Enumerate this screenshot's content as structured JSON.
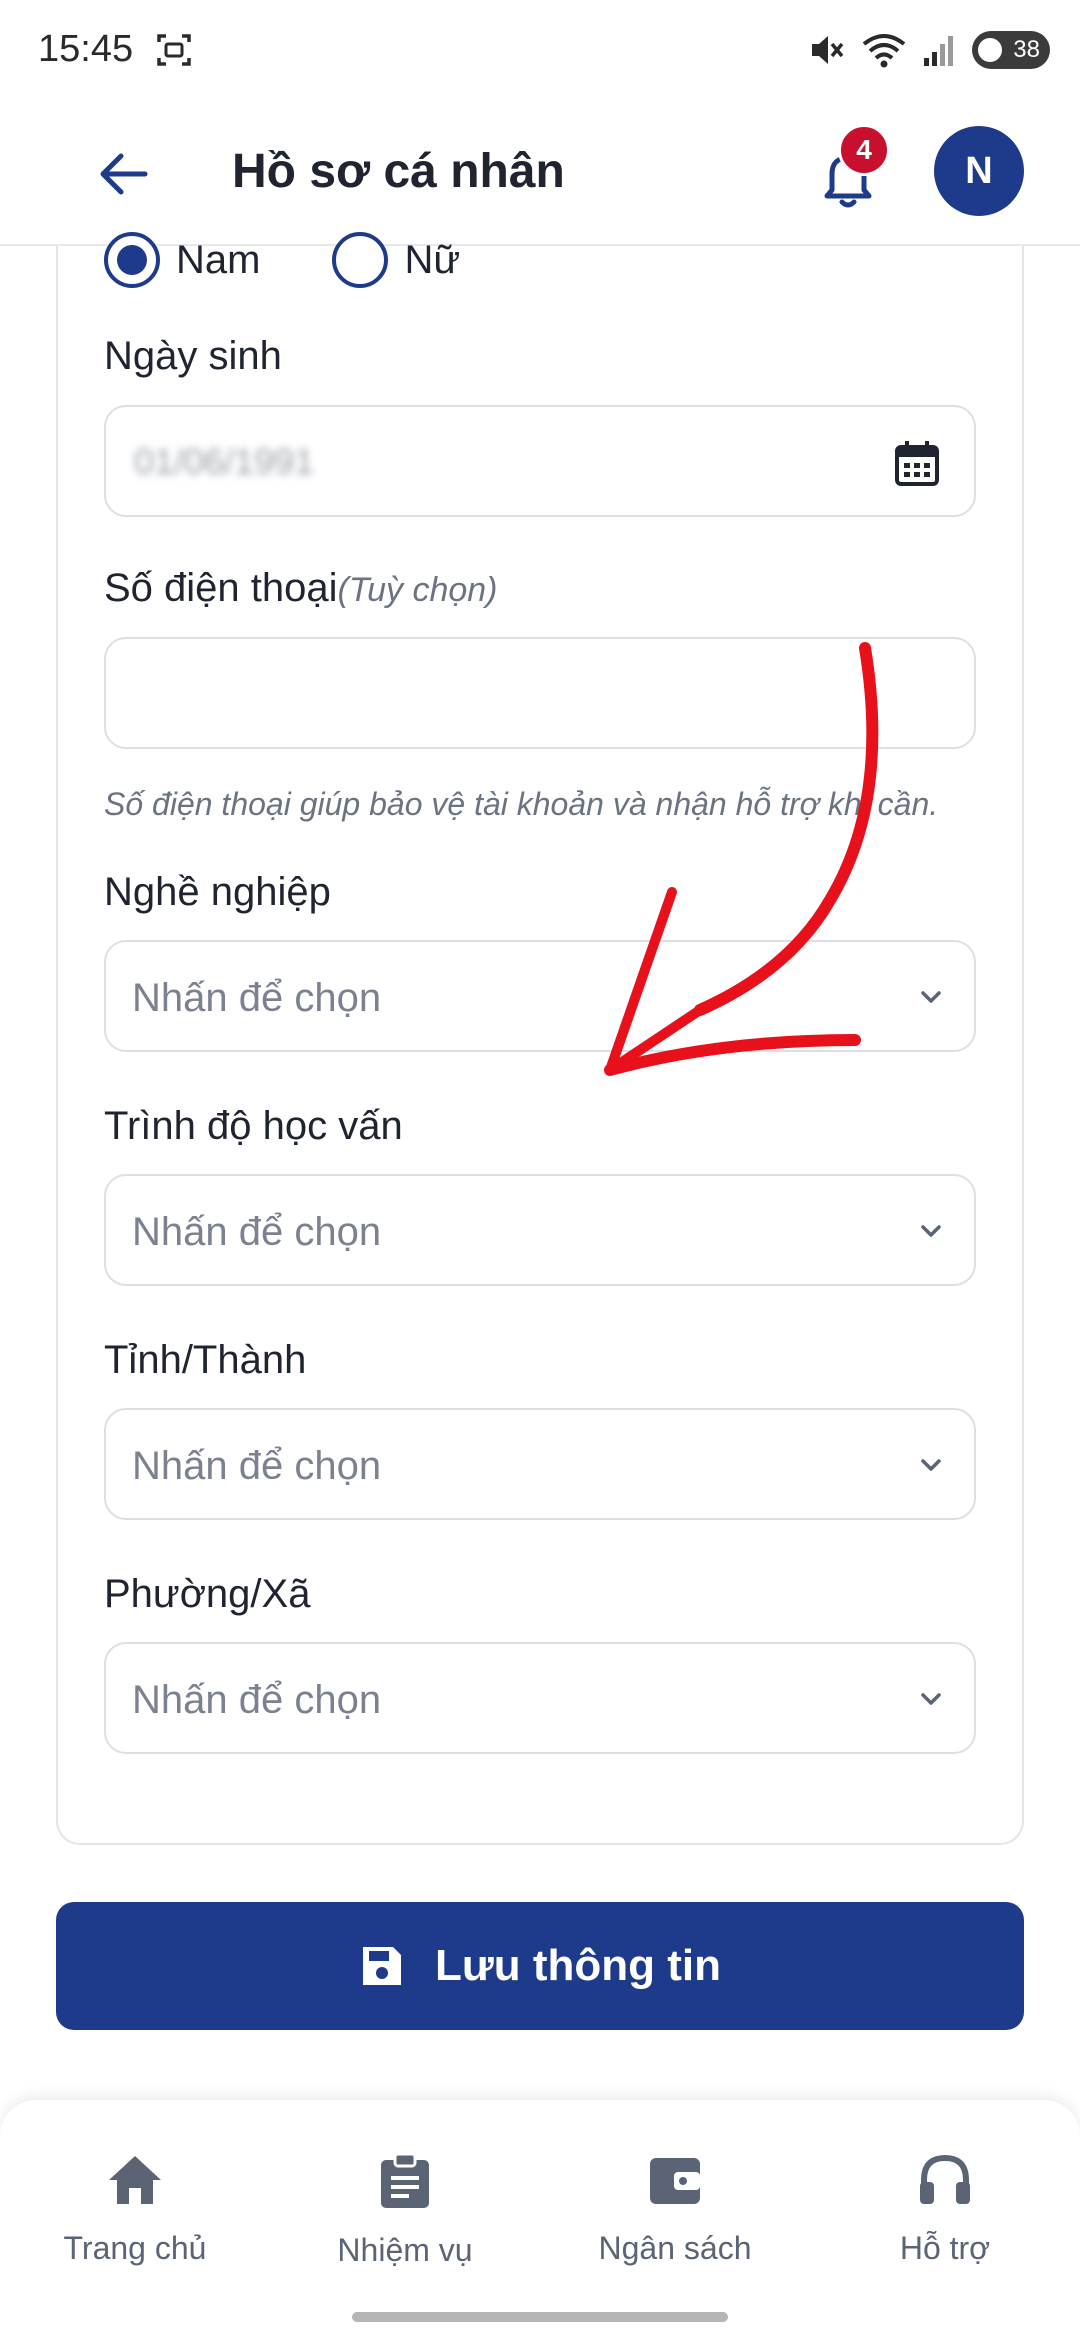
{
  "status_bar": {
    "time": "15:45",
    "battery": "38"
  },
  "header": {
    "title": "Hồ sơ cá nhân",
    "notification_count": "4",
    "avatar_initial": "N"
  },
  "form": {
    "gender": {
      "options": [
        "Nam",
        "Nữ"
      ],
      "selected": "Nam"
    },
    "birthdate": {
      "label": "Ngày sinh",
      "value": "01/06/1991"
    },
    "phone": {
      "label": "Số điện thoại",
      "optional": "(Tuỳ chọn)",
      "value": "",
      "helper": "Số điện thoại giúp bảo vệ tài khoản và nhận hỗ trợ khi cần."
    },
    "occupation": {
      "label": "Nghề nghiệp",
      "placeholder": "Nhấn để chọn"
    },
    "education": {
      "label": "Trình độ học vấn",
      "placeholder": "Nhấn để chọn"
    },
    "province": {
      "label": "Tỉnh/Thành",
      "placeholder": "Nhấn để chọn"
    },
    "ward": {
      "label": "Phường/Xã",
      "placeholder": "Nhấn để chọn"
    }
  },
  "save_button": {
    "label": "Lưu thông tin"
  },
  "bottom_nav": {
    "items": [
      {
        "label": "Trang chủ",
        "icon": "home-icon"
      },
      {
        "label": "Nhiệm vụ",
        "icon": "clipboard-icon"
      },
      {
        "label": "Ngân sách",
        "icon": "wallet-icon"
      },
      {
        "label": "Hỗ trợ",
        "icon": "headset-icon"
      }
    ]
  },
  "colors": {
    "primary": "#1e3a8a",
    "badge": "#c8102e",
    "annotation": "#e8101a"
  }
}
